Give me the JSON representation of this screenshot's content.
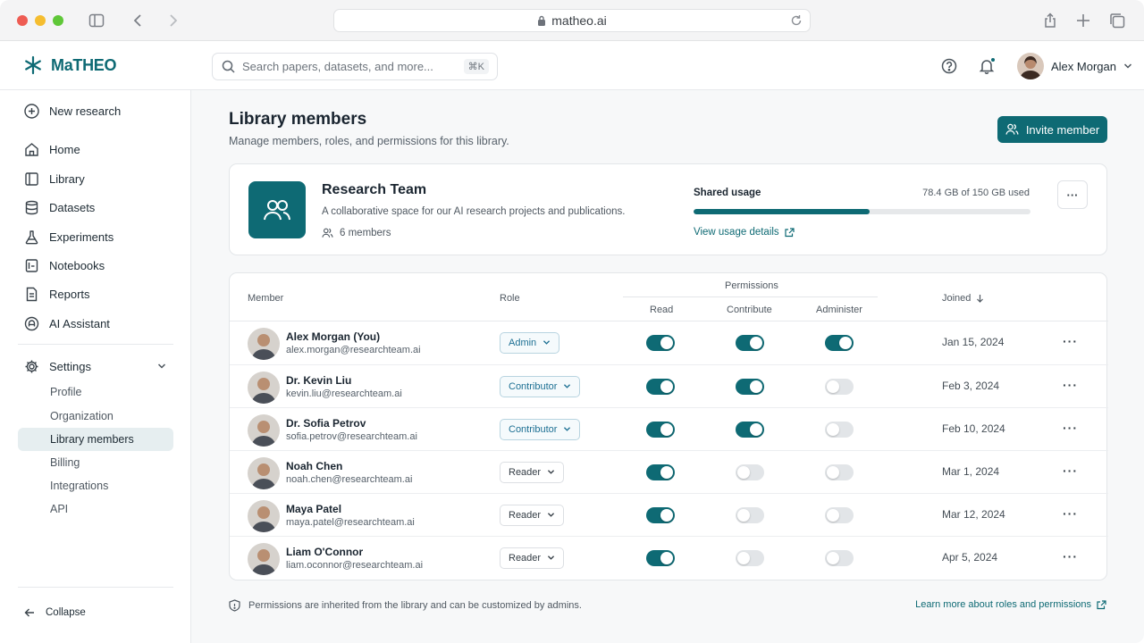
{
  "browser": {
    "url": "matheo.ai"
  },
  "app": {
    "brand": "MaTHEO",
    "search_placeholder": "Search papers, datasets, and more...",
    "search_shortcut": "⌘K",
    "user_name": "Alex Morgan"
  },
  "sidebar": {
    "new_research": "New research",
    "items": [
      {
        "label": "Home",
        "icon": "home-icon"
      },
      {
        "label": "Library",
        "icon": "book-icon"
      },
      {
        "label": "Datasets",
        "icon": "database-icon"
      },
      {
        "label": "Experiments",
        "icon": "flask-icon"
      },
      {
        "label": "Notebooks",
        "icon": "notebook-icon"
      },
      {
        "label": "Reports",
        "icon": "document-icon"
      },
      {
        "label": "AI Assistant",
        "icon": "assistant-icon"
      }
    ],
    "settings": "Settings",
    "settings_items": [
      "Profile",
      "Organization",
      "Library members",
      "Billing",
      "Integrations",
      "API"
    ],
    "active_item": "Library members",
    "collapse": "Collapse"
  },
  "page": {
    "title": "Library members",
    "subtitle": "Manage members, roles, and permissions for this library.",
    "invite_button": "Invite member"
  },
  "team": {
    "name": "Research Team",
    "description": "A collaborative space for our AI research projects and publications.",
    "members_count": "6 members",
    "usage_label": "Shared usage",
    "usage_value": "78.4 GB of 150 GB used",
    "usage_fraction": 0.523,
    "usage_link": "View usage details"
  },
  "table": {
    "headers": {
      "member": "Member",
      "role": "Role",
      "permissions": "Permissions",
      "read": "Read",
      "contribute": "Contribute",
      "administer": "Administer",
      "joined": "Joined"
    },
    "rows": [
      {
        "name": "Alex Morgan (You)",
        "email": "alex.morgan@researchteam.ai",
        "role": "Admin",
        "role_style": "accent",
        "read": true,
        "contribute": true,
        "administer": true,
        "joined": "Jan 15, 2024",
        "avatar_color": "#6b4a3c"
      },
      {
        "name": "Dr. Kevin Liu",
        "email": "kevin.liu@researchteam.ai",
        "role": "Contributor",
        "role_style": "accent",
        "read": true,
        "contribute": true,
        "administer": false,
        "joined": "Feb 3, 2024",
        "avatar_color": "#3b3330"
      },
      {
        "name": "Dr. Sofia Petrov",
        "email": "sofia.petrov@researchteam.ai",
        "role": "Contributor",
        "role_style": "accent",
        "read": true,
        "contribute": true,
        "administer": false,
        "joined": "Feb 10, 2024",
        "avatar_color": "#c9a27a"
      },
      {
        "name": "Noah Chen",
        "email": "noah.chen@researchteam.ai",
        "role": "Reader",
        "role_style": "plain",
        "read": true,
        "contribute": false,
        "administer": false,
        "joined": "Mar 1, 2024",
        "avatar_color": "#3d2b22"
      },
      {
        "name": "Maya Patel",
        "email": "maya.patel@researchteam.ai",
        "role": "Reader",
        "role_style": "plain",
        "read": true,
        "contribute": false,
        "administer": false,
        "joined": "Mar 12, 2024",
        "avatar_color": "#2f2018"
      },
      {
        "name": "Liam O'Connor",
        "email": "liam.oconnor@researchteam.ai",
        "role": "Reader",
        "role_style": "plain",
        "read": true,
        "contribute": false,
        "administer": false,
        "joined": "Apr 5, 2024",
        "avatar_color": "#5a4a3e"
      }
    ]
  },
  "footer": {
    "note": "Permissions are inherited from the library and can be customized by admins.",
    "learn_link": "Learn more about roles and permissions"
  },
  "colors": {
    "accent": "#0e6a74",
    "toggle_off": "#e2e5e8",
    "role_accent": "#1c6f93"
  }
}
